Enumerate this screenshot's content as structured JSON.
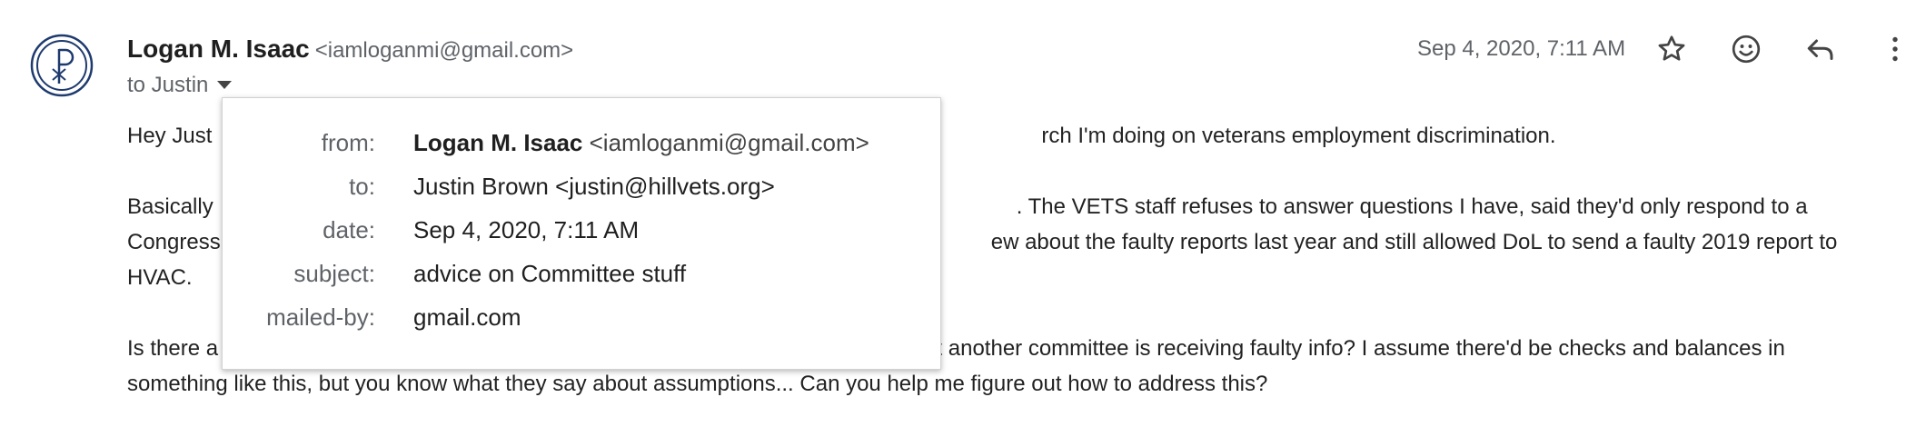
{
  "message": {
    "sender_name": "Logan M. Isaac",
    "sender_email": "<iamloganmi@gmail.com>",
    "to_line": "to Justin",
    "date": "Sep 4, 2020, 7:11 AM",
    "body": {
      "p1_visible_start": "Hey Just",
      "p1_visible_end": "rch I'm doing on veterans employment discrimination.",
      "p2_line1_start": "Basically",
      "p2_line1_end": ". The VETS staff refuses to answer questions I have, said they'd only respond to a",
      "p2_line2_start": "Congress",
      "p2_line2_end": "ew about the faulty reports last year and still allowed DoL to send a faulty 2019 report to",
      "p2_line3": "HVAC.",
      "p3_line1_start": "Is there a",
      "p3_line1_end": "that another committee is receiving faulty info? I assume there'd be checks and balances in",
      "p3_line2": "something like this, but you know what they say about assumptions... Can you help me figure out how to address this?"
    }
  },
  "details_popup": {
    "from_label": "from:",
    "from_name": "Logan M. Isaac",
    "from_email": "<iamloganmi@gmail.com>",
    "to_label": "to:",
    "to_value": "Justin Brown <justin@hillvets.org>",
    "date_label": "date:",
    "date_value": "Sep 4, 2020, 7:11 AM",
    "subject_label": "subject:",
    "subject_value": "advice on Committee stuff",
    "mailed_by_label": "mailed-by:",
    "mailed_by_value": "gmail.com"
  },
  "icons": [
    "avatar-logo",
    "star-icon",
    "emoji-reaction-icon",
    "reply-icon",
    "more-options-icon",
    "chevron-down-icon"
  ],
  "colors": {
    "avatar": "#1e3a6e",
    "muted": "#5f6368",
    "text": "#1f1f1f"
  }
}
